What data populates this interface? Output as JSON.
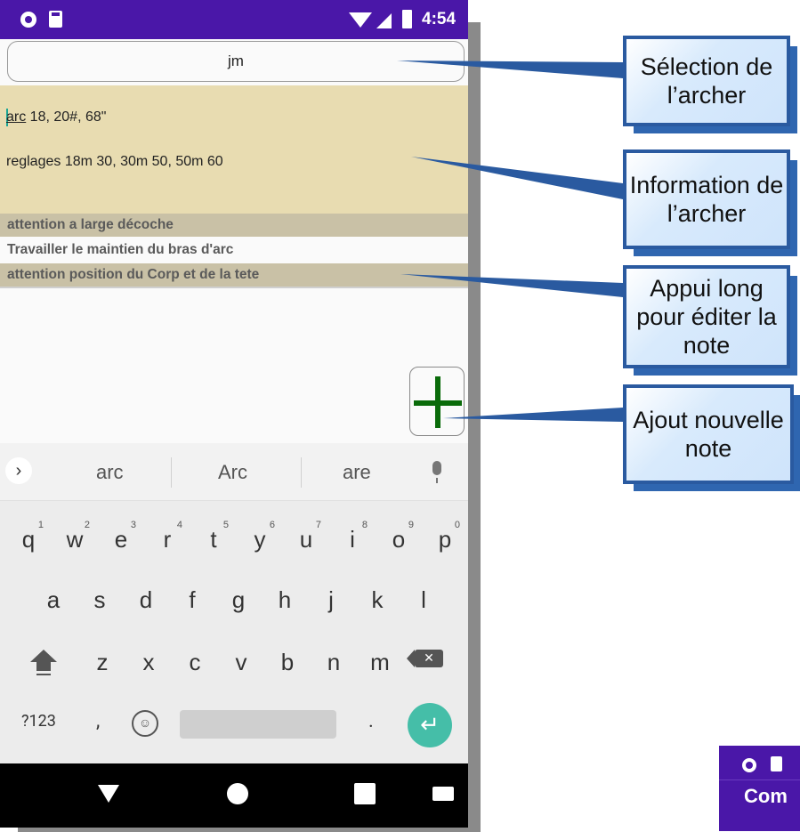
{
  "status_bar": {
    "time": "4:54"
  },
  "archer_selector": {
    "value": "jm"
  },
  "archer_info": {
    "line1_word": "arc",
    "line1_rest": " 18, 20#, 68\"",
    "line2": "reglages 18m 30, 30m 50, 50m 60"
  },
  "notes": [
    "attention a large décoche",
    "Travailler le maintien du bras d'arc",
    "attention position du Corp et de la tete"
  ],
  "keyboard": {
    "suggestions": [
      "arc",
      "Arc",
      "are"
    ],
    "row1": [
      {
        "k": "q",
        "n": "1"
      },
      {
        "k": "w",
        "n": "2"
      },
      {
        "k": "e",
        "n": "3"
      },
      {
        "k": "r",
        "n": "4"
      },
      {
        "k": "t",
        "n": "5"
      },
      {
        "k": "y",
        "n": "6"
      },
      {
        "k": "u",
        "n": "7"
      },
      {
        "k": "i",
        "n": "8"
      },
      {
        "k": "o",
        "n": "9"
      },
      {
        "k": "p",
        "n": "0"
      }
    ],
    "row2": [
      "a",
      "s",
      "d",
      "f",
      "g",
      "h",
      "j",
      "k",
      "l"
    ],
    "row3": [
      "z",
      "x",
      "c",
      "v",
      "b",
      "n",
      "m"
    ],
    "key_123": "?123",
    "key_comma": ",",
    "key_dot": "."
  },
  "callouts": {
    "selection": "Sélection de l’archer",
    "information": "Information de l’archer",
    "long_press": "Appui long pour éditer la note",
    "add": "Ajout nouvelle note"
  },
  "mini_preview": {
    "title": "Com"
  },
  "colors": {
    "status_bar": "#4a17a8",
    "info_background": "#e8dcb1",
    "note_highlight": "#c9c1a6",
    "add_icon": "#0a6b0a",
    "enter_key": "#45bea8",
    "callout_border": "#2a5aa0"
  },
  "icons": [
    "status-circle-icon",
    "sd-card-icon",
    "wifi-icon",
    "signal-icon",
    "battery-icon",
    "plus-icon",
    "chevron-right-icon",
    "mic-icon",
    "shift-icon",
    "backspace-icon",
    "emoji-icon",
    "enter-icon",
    "nav-back-icon",
    "nav-home-icon",
    "nav-recents-icon",
    "nav-keyboard-icon"
  ]
}
